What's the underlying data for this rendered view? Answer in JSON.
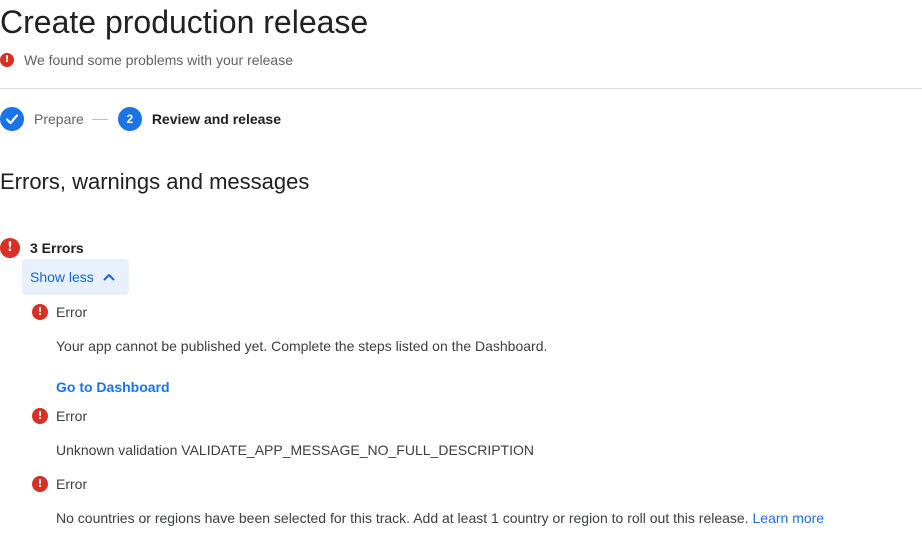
{
  "page": {
    "title": "Create production release",
    "problem_banner": "We found some problems with your release"
  },
  "stepper": {
    "steps": [
      {
        "number": "",
        "label": "Prepare",
        "state": "done"
      },
      {
        "number": "2",
        "label": "Review and release",
        "state": "current"
      }
    ]
  },
  "section": {
    "title": "Errors, warnings and messages"
  },
  "errors": {
    "count_label": "3 Errors",
    "toggle_label": "Show less",
    "items": [
      {
        "severity": "Error",
        "message": "Your app cannot be published yet. Complete the steps listed on the Dashboard.",
        "link": "Go to Dashboard"
      },
      {
        "severity": "Error",
        "message": "Unknown validation VALIDATE_APP_MESSAGE_NO_FULL_DESCRIPTION"
      },
      {
        "severity": "Error",
        "message": "No countries or regions have been selected for this track. Add at least 1 country or region to roll out this release.",
        "link": "Learn more"
      }
    ]
  },
  "colors": {
    "error": "#d93025",
    "accent": "#1a73e8",
    "toggle_bg": "#e8f0fe"
  },
  "icons": {
    "error": "error-circle-icon",
    "done_step": "check-icon",
    "toggle": "chevron-up-icon"
  }
}
